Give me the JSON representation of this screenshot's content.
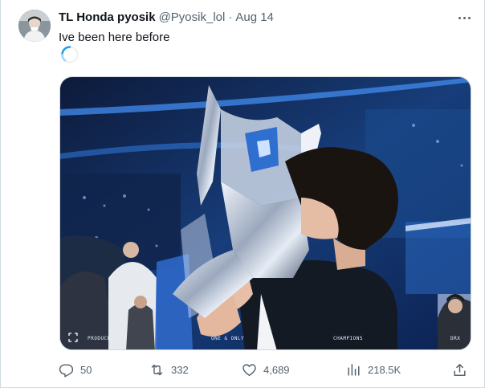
{
  "tweet": {
    "display_name": "TL Honda pyosik",
    "handle": "@Pyosik_lol",
    "separator": "·",
    "date": "Aug 14",
    "text": "Ive been here before"
  },
  "media": {
    "captions": [
      "PRODUCED",
      "ONE & ONLY",
      "CHAMPIONS",
      "DRX"
    ]
  },
  "actions": {
    "replies": "50",
    "reposts": "332",
    "likes": "4,689",
    "views": "218.5K"
  },
  "icons": {
    "reply": "reply-icon",
    "repost": "repost-icon",
    "like": "heart-icon",
    "views": "views-icon",
    "share": "share-icon",
    "more": "more-icon",
    "expand": "expand-icon",
    "loading": "loading-spinner-icon"
  },
  "colors": {
    "text_primary": "#0f1419",
    "text_secondary": "#536471",
    "border": "#cfd9de",
    "spinner": "#1d9bf0"
  }
}
